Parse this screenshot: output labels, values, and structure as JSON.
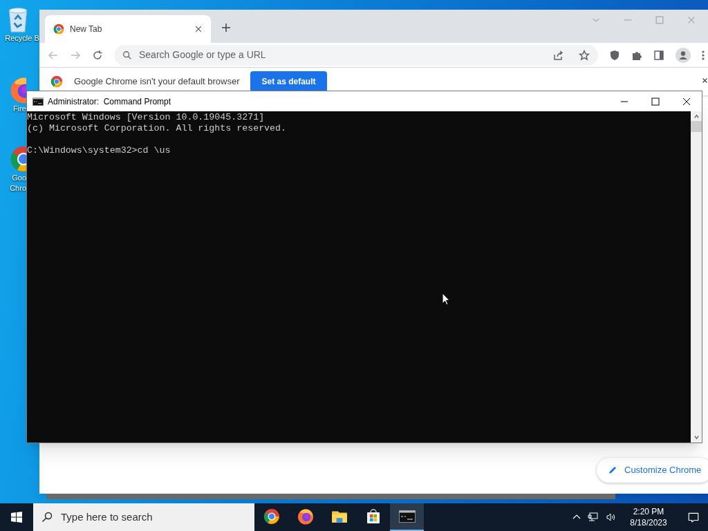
{
  "desktop_icons": [
    {
      "kind": "recycle",
      "lines": [
        "Recycle B"
      ]
    },
    {
      "kind": "firefox",
      "lines": [
        "Fire"
      ]
    },
    {
      "kind": "chrome",
      "lines": [
        "Goo",
        "Chro"
      ]
    }
  ],
  "browser": {
    "tabs": [
      {
        "label": "New Tab",
        "selected": true
      }
    ],
    "omnibox": {
      "placeholder": "Search Google or type a URL"
    },
    "infobar": {
      "message": "Google Chrome isn't your default browser",
      "button": "Set as default"
    },
    "customize_button": "Customize Chrome"
  },
  "console": {
    "title": "Administrator:  Command Prompt",
    "banner": [
      "Microsoft Windows [Version 10.0.19045.3271]",
      "(c) Microsoft Corporation. All rights reserved."
    ],
    "prompt": "C:\\Windows\\system32>cd \\us"
  },
  "taskbar": {
    "search": {
      "placeholder": "Type here to search"
    },
    "apps": [
      {
        "kind": "chrome",
        "active": false
      },
      {
        "kind": "firefox",
        "active": false
      },
      {
        "kind": "explorer",
        "active": false
      },
      {
        "kind": "store",
        "active": false
      },
      {
        "kind": "console",
        "active": true
      }
    ],
    "time": "2:20 PM",
    "date": "8/18/2023"
  }
}
